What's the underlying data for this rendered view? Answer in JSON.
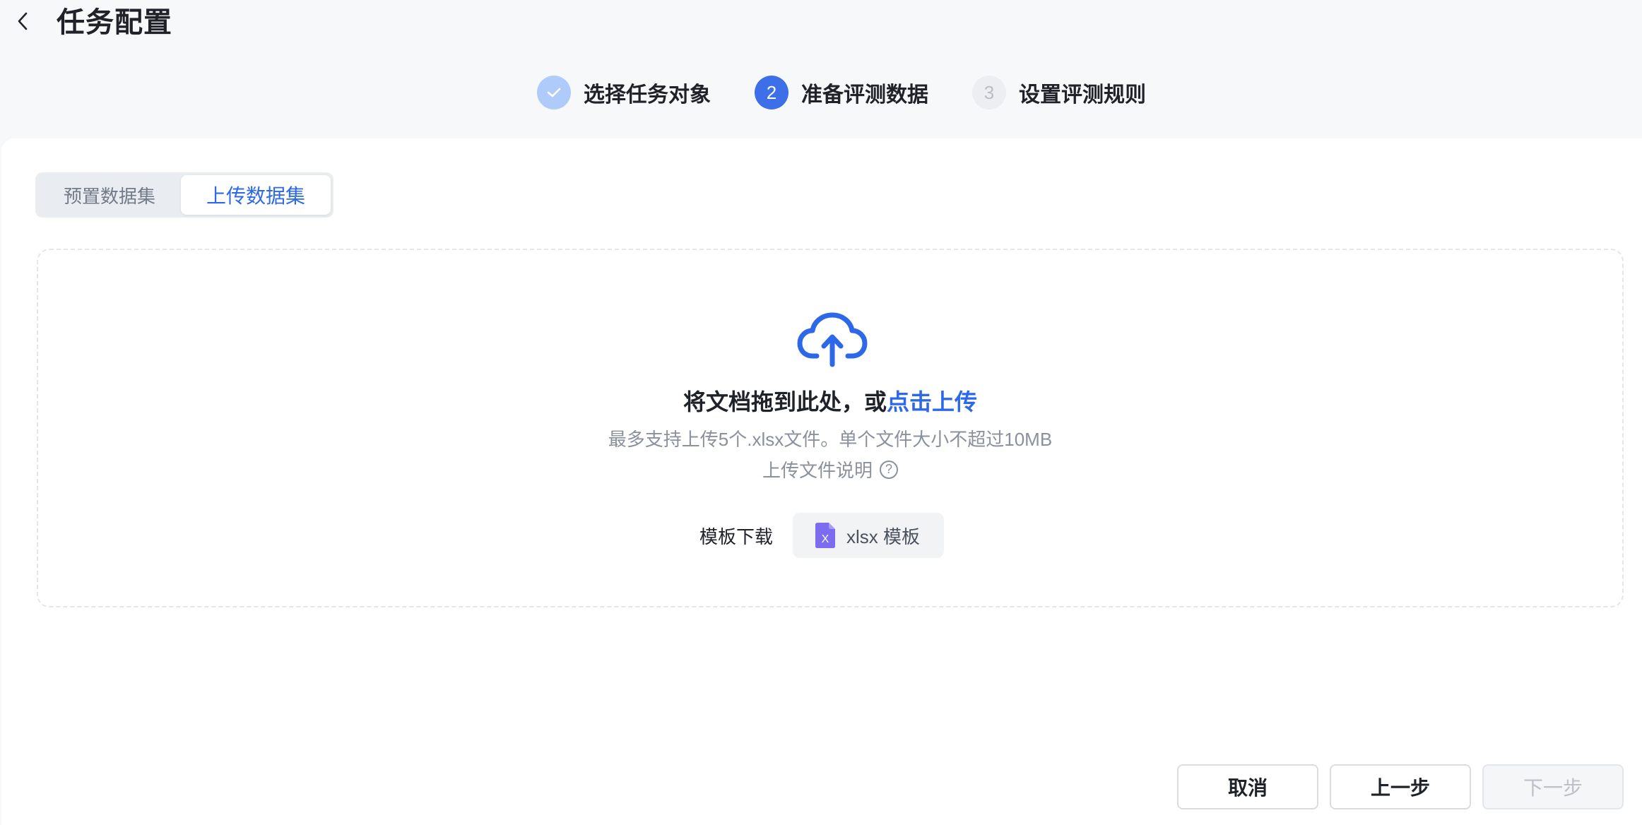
{
  "header": {
    "title": "任务配置"
  },
  "steps": [
    {
      "number": "",
      "label": "选择任务对象",
      "state": "done"
    },
    {
      "number": "2",
      "label": "准备评测数据",
      "state": "active"
    },
    {
      "number": "3",
      "label": "设置评测规则",
      "state": "pending"
    }
  ],
  "tabs": [
    {
      "label": "预置数据集",
      "active": false
    },
    {
      "label": "上传数据集",
      "active": true
    }
  ],
  "upload": {
    "title_text": "将文档拖到此处，或",
    "title_link": "点击上传",
    "hint": "最多支持上传5个.xlsx文件。单个文件大小不超过10MB",
    "help_text": "上传文件说明",
    "help_glyph": "?",
    "template_label": "模板下载",
    "template_button": "xlsx 模板",
    "template_file_glyph": "X"
  },
  "footer": {
    "cancel": "取消",
    "prev": "上一步",
    "next": "下一步"
  },
  "colors": {
    "primary": "#2c68e8",
    "step_done": "#aecbf9",
    "step_active": "#3c6fe8",
    "file_icon": "#7b6cf0"
  }
}
